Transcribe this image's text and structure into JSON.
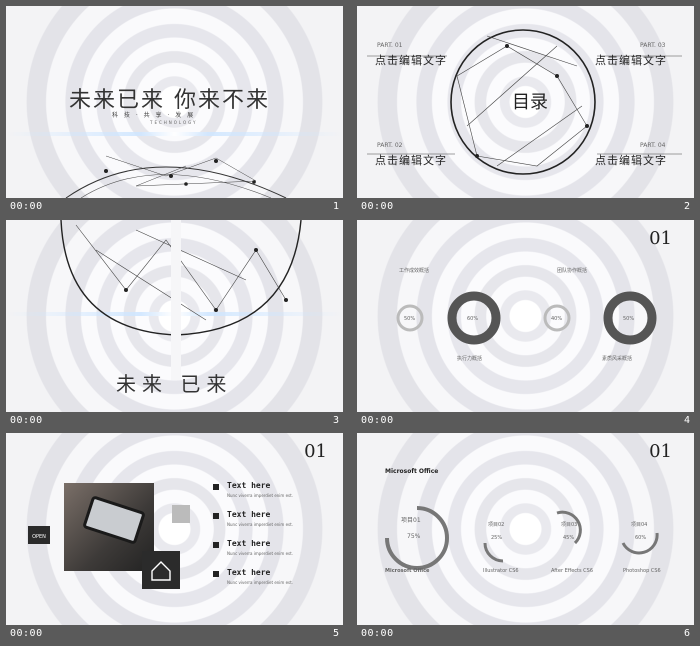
{
  "slides": [
    {
      "num": "1",
      "time": "00:00",
      "title": "未来已来 你来不来",
      "subtitle": "科 技 · 共 享 · 发 展",
      "eng": "TECHNOLOGY"
    },
    {
      "num": "2",
      "time": "00:00",
      "center": "目录",
      "parts": [
        "PART. 01",
        "PART. 02",
        "PART. 03",
        "PART. 04"
      ],
      "labels": [
        "点击编辑文字",
        "点击编辑文字",
        "点击编辑文字",
        "点击编辑文字"
      ]
    },
    {
      "num": "3",
      "time": "00:00",
      "title": "未来 已来"
    },
    {
      "num": "4",
      "time": "00:00",
      "page": "01",
      "heads": [
        "工作成效概括",
        "团队协作概括",
        "执行力概括",
        "素质风采概括"
      ],
      "pcts": [
        "50%",
        "60%",
        "40%",
        "50%"
      ]
    },
    {
      "num": "5",
      "time": "00:00",
      "page": "01",
      "open": "OPEN",
      "items": [
        "Text here",
        "Text here",
        "Text here",
        "Text here"
      ],
      "sub": "Nunc viverra imperdiet enim est."
    },
    {
      "num": "6",
      "time": "00:00",
      "page": "01",
      "head": "Microsoft Office",
      "projects": [
        "项目01",
        "项目02",
        "项目03",
        "项目04"
      ],
      "pcts": [
        "75%",
        "25%",
        "45%",
        "60%"
      ],
      "apps": [
        "Microsoft Office",
        "Illustrator CS6",
        "After Effects CS6",
        "Photoshop CS6"
      ]
    }
  ]
}
